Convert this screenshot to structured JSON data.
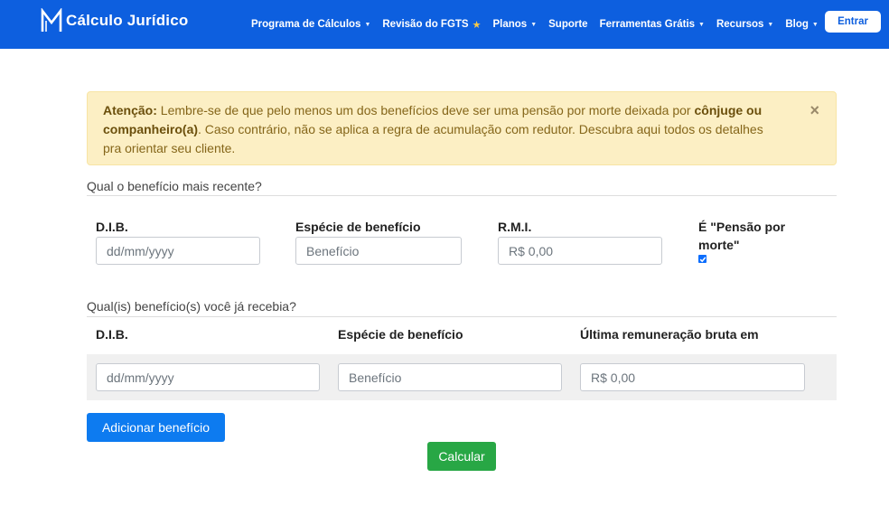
{
  "brand": {
    "name": "Cálculo Jurídico",
    "logo_icon": "cj-logo-icon"
  },
  "nav": {
    "items": [
      {
        "label": "Programa de Cálculos",
        "dropdown": true
      },
      {
        "label": "Revisão do FGTS",
        "star": true
      },
      {
        "label": "Planos",
        "dropdown": true
      },
      {
        "label": "Suporte"
      },
      {
        "label": "Ferramentas Grátis",
        "dropdown": true
      },
      {
        "label": "Recursos",
        "dropdown": true
      },
      {
        "label": "Blog",
        "dropdown": true
      }
    ],
    "caret": "▼",
    "star": "★",
    "login_label": "Entrar"
  },
  "alert": {
    "strong1": "Atenção:",
    "text1": " Lembre-se de que pelo menos um dos benefícios deve ser uma pensão por morte deixada por ",
    "strong2": "cônjuge ou companheiro(a)",
    "text2": ". Caso contrário, não se aplica a regra de acumulação com redutor. Descubra aqui todos os detalhes pra orientar seu cliente.",
    "close": "×"
  },
  "recent": {
    "title": "Qual o benefício mais recente?",
    "dib_label": "D.I.B.",
    "dib_placeholder": "dd/mm/yyyy",
    "especie_label": "Espécie de benefício",
    "especie_placeholder": "Benefício",
    "rmi_label": "R.M.I.",
    "rmi_placeholder": "R$ 0,00",
    "pensao_label_line1": "É \"Pensão por",
    "pensao_label_line2": "morte\"",
    "pensao_checked": true
  },
  "previous": {
    "title": "Qual(is) benefício(s) você já recebia?",
    "dib_label": "D.I.B.",
    "especie_label": "Espécie de benefício",
    "remuneracao_label": "Última remuneração bruta em",
    "dib_placeholder": "dd/mm/yyyy",
    "especie_placeholder": "Benefício",
    "remuneracao_placeholder": "R$ 0,00"
  },
  "actions": {
    "add_label": "Adicionar benefício",
    "calc_label": "Calcular"
  },
  "colors": {
    "navbar": "#0d5fdf",
    "alert_bg": "#fcefc4",
    "add_button": "#0d7bf0",
    "calc_button": "#28a745"
  }
}
